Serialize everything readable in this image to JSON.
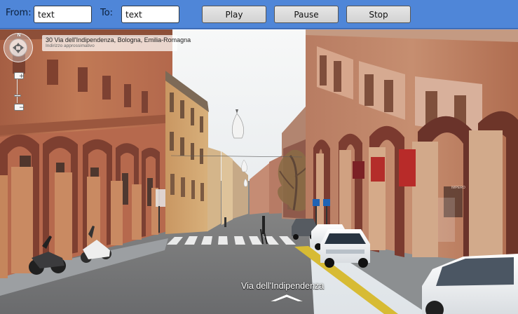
{
  "toolbar": {
    "from_label": "From:",
    "from_value": "text",
    "to_label": "To:",
    "to_value": "text",
    "play_label": "Play",
    "pause_label": "Pause",
    "stop_label": "Stop"
  },
  "street_view": {
    "address": "30 Via dell'Indipendenza, Bologna, Emilia-Romagna",
    "address_note": "Indirizzo approssimativo",
    "street_name": "Via dell'Indipendenza",
    "compass_north": "N",
    "zoom_in": "+",
    "zoom_out": "−",
    "zoom_level": "low",
    "shop_sign": "IMPERO"
  },
  "colors": {
    "toolbar": "#4f86d8",
    "button": "#dedede",
    "input": "#ffffff",
    "building_left": "#b96a4a",
    "building_right": "#c18766",
    "road": "#78797b",
    "sky": "#e8edf2"
  },
  "icons": {
    "pan_control": "navigation-pan-icon",
    "direction_arrow": "street-direction-chevron-icon",
    "chandelier": "chandelier-icon"
  }
}
